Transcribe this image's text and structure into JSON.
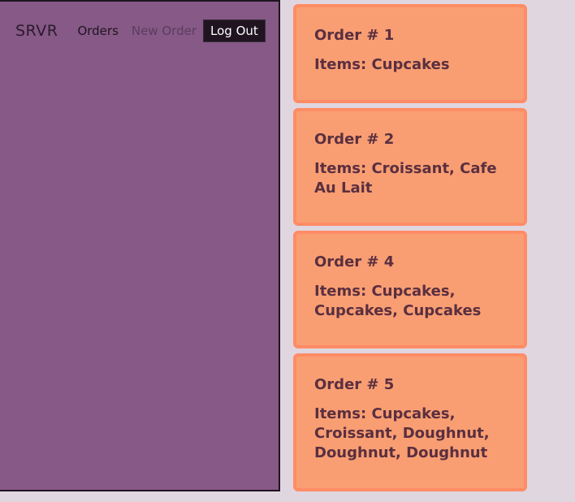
{
  "nav": {
    "brand": "SRVR",
    "orders_label": "Orders",
    "new_order_label": "New Order",
    "logout_label": "Log Out"
  },
  "orders": [
    {
      "title": "Order # 1",
      "items": "Items: Cupcakes"
    },
    {
      "title": "Order # 2",
      "items": "Items: Croissant, Cafe Au Lait"
    },
    {
      "title": "Order # 4",
      "items": "Items: Cupcakes, Cupcakes, Cupcakes"
    },
    {
      "title": "Order # 5",
      "items": "Items: Cupcakes, Croissant, Doughnut, Doughnut, Doughnut"
    }
  ]
}
